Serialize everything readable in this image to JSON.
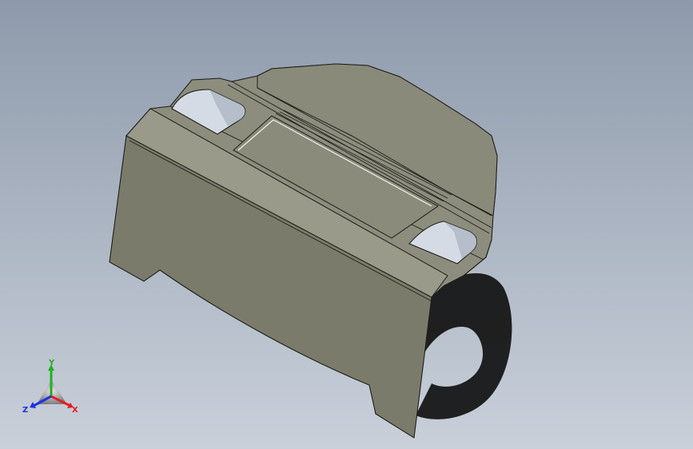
{
  "viewport": {
    "background_top": "#8e9aab",
    "background_bottom": "#c9d0da"
  },
  "model": {
    "face_color": "#7b7b6b",
    "top_color": "#8f8f80",
    "edge_color": "#1e1e1a",
    "shadow_color": "#0f0f0f"
  },
  "triad": {
    "x_label": "X",
    "y_label": "Y",
    "z_label": "Z",
    "x_color": "#e02020",
    "y_color": "#20b020",
    "z_color": "#2030e0"
  }
}
